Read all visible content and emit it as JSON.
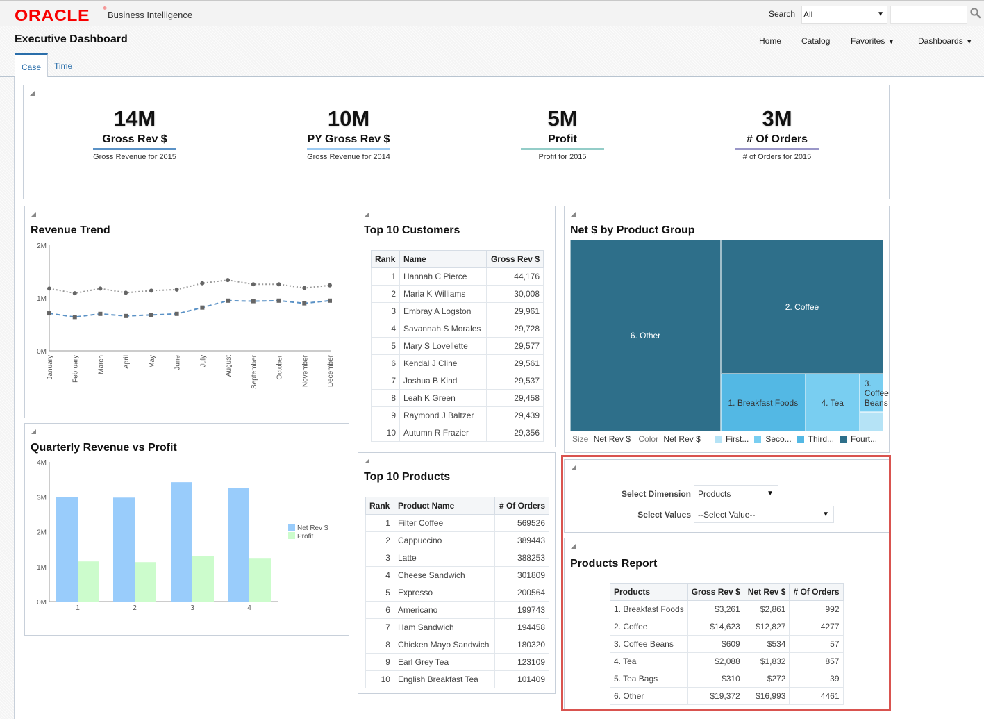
{
  "app": {
    "brand": "ORACLE",
    "product": "Business Intelligence",
    "search_label": "Search",
    "search_scope": "All",
    "search_value": ""
  },
  "header": {
    "title": "Executive Dashboard",
    "nav": [
      {
        "label": "Home",
        "has_menu": false
      },
      {
        "label": "Catalog",
        "has_menu": false
      },
      {
        "label": "Favorites",
        "has_menu": true
      },
      {
        "label": "Dashboards",
        "has_menu": true
      }
    ],
    "tabs": [
      {
        "label": "Case",
        "active": true
      },
      {
        "label": "Time",
        "active": false
      }
    ]
  },
  "kpis": [
    {
      "value": "14M",
      "label": "Gross Rev $",
      "sub": "Gross Revenue for 2015",
      "color": "#5b92c6"
    },
    {
      "value": "10M",
      "label": "PY Gross Rev $",
      "sub": "Gross Revenue for 2014",
      "color": "#9ccaf2"
    },
    {
      "value": "5M",
      "label": "Profit",
      "sub": "Profit for 2015",
      "color": "#94cdc8"
    },
    {
      "value": "3M",
      "label": "# Of Orders",
      "sub": "# of Orders for 2015",
      "color": "#9a97c8"
    }
  ],
  "revenue_trend": {
    "title": "Revenue Trend"
  },
  "quarterly": {
    "title": "Quarterly Revenue vs Profit"
  },
  "top_customers": {
    "title": "Top 10 Customers",
    "columns": [
      "Rank",
      "Name",
      "Gross Rev $"
    ],
    "rows": [
      [
        "1",
        "Hannah C Pierce",
        "44,176"
      ],
      [
        "2",
        "Maria K Williams",
        "30,008"
      ],
      [
        "3",
        "Embray A Logston",
        "29,961"
      ],
      [
        "4",
        "Savannah S Morales",
        "29,728"
      ],
      [
        "5",
        "Mary S Lovellette",
        "29,577"
      ],
      [
        "6",
        "Kendal J Cline",
        "29,561"
      ],
      [
        "7",
        "Joshua B Kind",
        "29,537"
      ],
      [
        "8",
        "Leah K Green",
        "29,458"
      ],
      [
        "9",
        "Raymond J Baltzer",
        "29,439"
      ],
      [
        "10",
        "Autumn R Frazier",
        "29,356"
      ]
    ]
  },
  "top_products": {
    "title": "Top 10 Products",
    "columns": [
      "Rank",
      "Product Name",
      "# Of Orders"
    ],
    "rows": [
      [
        "1",
        "Filter Coffee",
        "569526"
      ],
      [
        "2",
        "Cappuccino",
        "389443"
      ],
      [
        "3",
        "Latte",
        "388253"
      ],
      [
        "4",
        "Cheese Sandwich",
        "301809"
      ],
      [
        "5",
        "Expresso",
        "200564"
      ],
      [
        "6",
        "Americano",
        "199743"
      ],
      [
        "7",
        "Ham Sandwich",
        "194458"
      ],
      [
        "8",
        "Chicken Mayo Sandwich",
        "180320"
      ],
      [
        "9",
        "Earl Grey Tea",
        "123109"
      ],
      [
        "10",
        "English Breakfast Tea",
        "101409"
      ]
    ]
  },
  "treemap": {
    "title": "Net $ by Product Group",
    "size_label": "Size",
    "size_measure": "Net Rev $",
    "color_label": "Color",
    "color_measure": "Net Rev $",
    "legend": [
      {
        "label": "First...",
        "color": "#b5e3f6"
      },
      {
        "label": "Seco...",
        "color": "#79cef1"
      },
      {
        "label": "Third...",
        "color": "#53b8e4"
      },
      {
        "label": "Fourt...",
        "color": "#2e6f8a"
      }
    ]
  },
  "prompts": {
    "dimension_label": "Select Dimension",
    "dimension_value": "Products",
    "values_label": "Select Values",
    "values_value": "--Select Value--"
  },
  "products_report": {
    "title": "Products Report",
    "columns": [
      "Products",
      "Gross Rev $",
      "Net Rev $",
      "# Of Orders"
    ],
    "rows": [
      [
        "1. Breakfast Foods",
        "$3,261",
        "$2,861",
        "992"
      ],
      [
        "2. Coffee",
        "$14,623",
        "$12,827",
        "4277"
      ],
      [
        "3. Coffee Beans",
        "$609",
        "$534",
        "57"
      ],
      [
        "4. Tea",
        "$2,088",
        "$1,832",
        "857"
      ],
      [
        "5. Tea Bags",
        "$310",
        "$272",
        "39"
      ],
      [
        "6. Other",
        "$19,372",
        "$16,993",
        "4461"
      ]
    ]
  },
  "chart_data": [
    {
      "type": "line",
      "title": "Revenue Trend",
      "categories": [
        "January",
        "February",
        "March",
        "April",
        "May",
        "June",
        "July",
        "August",
        "September",
        "October",
        "November",
        "December"
      ],
      "series": [
        {
          "name": "Gross Rev $",
          "style": "dotted-circle",
          "color": "#8a8a8a",
          "values": [
            1.18,
            1.09,
            1.18,
            1.1,
            1.14,
            1.16,
            1.28,
            1.34,
            1.26,
            1.26,
            1.19,
            1.24
          ]
        },
        {
          "name": "Net Rev $",
          "style": "dashed-square",
          "color": "#5b92c6",
          "values": [
            0.71,
            0.64,
            0.7,
            0.66,
            0.68,
            0.7,
            0.82,
            0.95,
            0.94,
            0.95,
            0.9,
            0.95
          ]
        }
      ],
      "unit": "M",
      "yticks": [
        "0M",
        "1M",
        "2M"
      ],
      "ylim": [
        0,
        2
      ],
      "grid": false
    },
    {
      "type": "bar",
      "title": "Quarterly Revenue vs Profit",
      "categories": [
        "1",
        "2",
        "3",
        "4"
      ],
      "series": [
        {
          "name": "Net Rev $",
          "color": "#99ccfb",
          "values": [
            3.0,
            2.98,
            3.42,
            3.25
          ]
        },
        {
          "name": "Profit",
          "color": "#ccfccc",
          "values": [
            1.15,
            1.13,
            1.31,
            1.25
          ]
        }
      ],
      "unit": "M",
      "yticks": [
        "0M",
        "1M",
        "2M",
        "3M",
        "4M"
      ],
      "ylim": [
        0,
        4
      ],
      "legend": "right",
      "grid": false
    },
    {
      "type": "treemap",
      "title": "Net $ by Product Group",
      "items": [
        {
          "name": "6. Other",
          "value": 16993,
          "bucket": 4
        },
        {
          "name": "2. Coffee",
          "value": 12827,
          "bucket": 4
        },
        {
          "name": "1. Breakfast Foods",
          "value": 2861,
          "bucket": 3
        },
        {
          "name": "4. Tea",
          "value": 1832,
          "bucket": 2
        },
        {
          "name": "3. Coffee Beans",
          "value": 534,
          "bucket": 2
        },
        {
          "name": "5. Tea Bags",
          "value": 272,
          "bucket": 1
        }
      ]
    }
  ]
}
